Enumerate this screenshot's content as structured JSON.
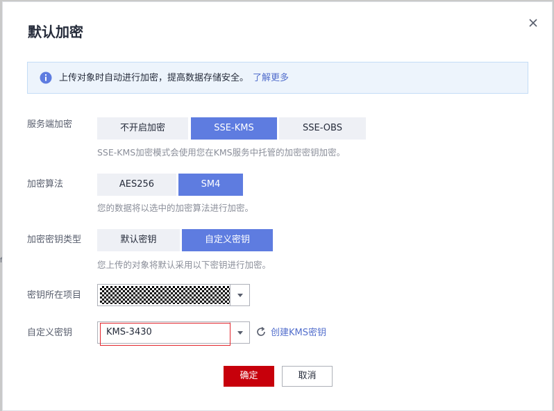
{
  "dialog": {
    "title": "默认加密",
    "close_icon": "close-icon"
  },
  "info": {
    "icon": "info-icon",
    "text": "上传对象时自动进行加密，提高数据存储安全。",
    "link": "了解更多"
  },
  "server_encryption": {
    "label": "服务端加密",
    "options": [
      "不开启加密",
      "SSE-KMS",
      "SSE-OBS"
    ],
    "selected": "SSE-KMS",
    "hint": "SSE-KMS加密模式会使用您在KMS服务中托管的加密密钥加密。"
  },
  "algorithm": {
    "label": "加密算法",
    "options": [
      "AES256",
      "SM4"
    ],
    "selected": "SM4",
    "hint": "您的数据将以选中的加密算法进行加密。"
  },
  "key_type": {
    "label": "加密密钥类型",
    "options": [
      "默认密钥",
      "自定义密钥"
    ],
    "selected": "自定义密钥",
    "hint": "您上传的对象将默认采用以下密钥进行加密。"
  },
  "key_project": {
    "label": "密钥所在项目"
  },
  "custom_key": {
    "label": "自定义密钥",
    "value": "KMS-3430",
    "refresh_icon": "refresh-icon",
    "create_link": "创建KMS密钥"
  },
  "footer": {
    "ok": "确定",
    "cancel": "取消"
  },
  "colors": {
    "primary": "#5e7ce0",
    "confirm": "#c7000b",
    "link": "#526ecc",
    "highlight": "#e3242b"
  }
}
